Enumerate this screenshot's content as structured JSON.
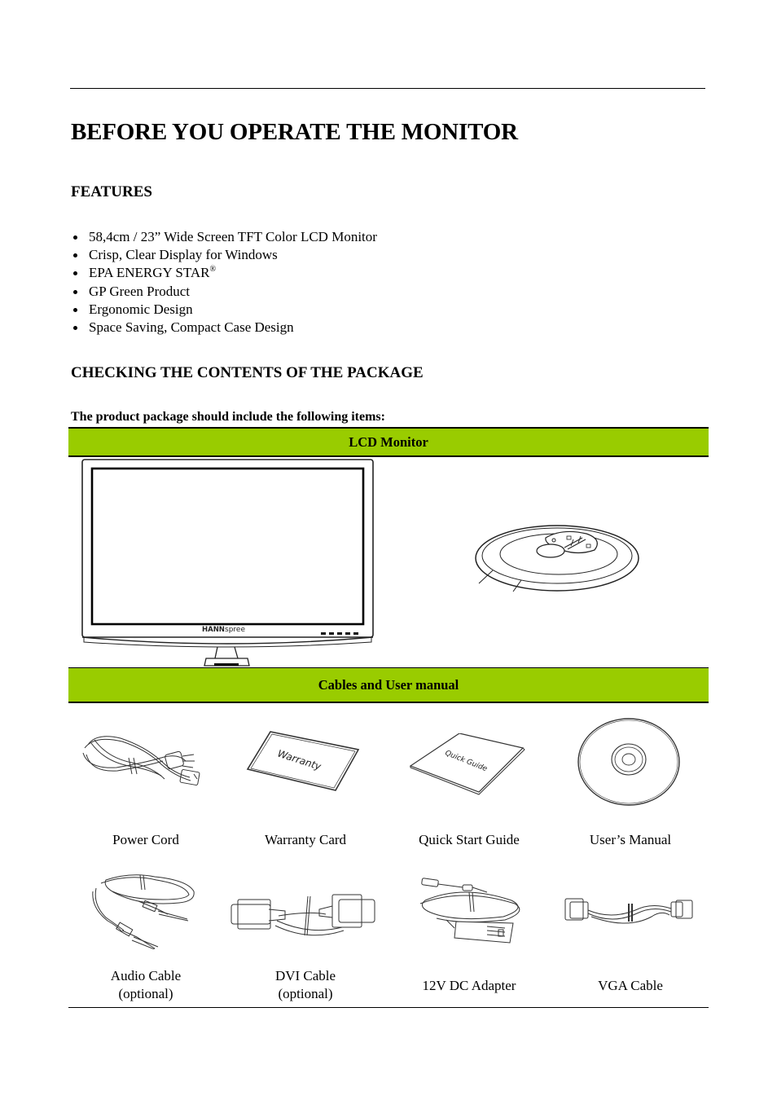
{
  "page": {
    "title": "BEFORE YOU OPERATE THE MONITOR",
    "features": {
      "heading": "FEATURES",
      "items": [
        {
          "text": "58,4cm / 23” Wide Screen TFT Color LCD Monitor",
          "sup": ""
        },
        {
          "text": "Crisp, Clear Display for Windows",
          "sup": ""
        },
        {
          "text": "EPA ENERGY STAR",
          "sup": "®"
        },
        {
          "text": "GP Green Product",
          "sup": ""
        },
        {
          "text": "Ergonomic Design",
          "sup": ""
        },
        {
          "text": "Space Saving, Compact Case Design",
          "sup": ""
        }
      ]
    },
    "package": {
      "heading": "CHECKING THE CONTENTS OF THE PACKAGE",
      "intro": "The product package should include the following items:",
      "section_monitor": {
        "label": "LCD Monitor",
        "monitor_brand_prefix": "HANN",
        "monitor_brand_suffix": "spree"
      },
      "section_cables": {
        "label": "Cables and User manual",
        "items": [
          {
            "caption_line1": "Power Cord",
            "caption_line2": "",
            "icon": "power-cord-icon"
          },
          {
            "caption_line1": "Warranty Card",
            "caption_line2": "",
            "icon": "warranty-card-icon",
            "card_text": "Warranty"
          },
          {
            "caption_line1": "Quick Start Guide",
            "caption_line2": "",
            "icon": "quick-guide-icon",
            "card_text": "Quick Guide"
          },
          {
            "caption_line1": "User’s Manual",
            "caption_line2": "",
            "icon": "cd-icon"
          },
          {
            "caption_line1": "Audio Cable",
            "caption_line2": "(optional)",
            "icon": "audio-cable-icon"
          },
          {
            "caption_line1": "DVI Cable",
            "caption_line2": "(optional)",
            "icon": "dvi-cable-icon"
          },
          {
            "caption_line1": "12V DC Adapter",
            "caption_line2": "",
            "icon": "dc-adapter-icon"
          },
          {
            "caption_line1": "VGA Cable",
            "caption_line2": "",
            "icon": "vga-cable-icon"
          }
        ]
      }
    }
  }
}
